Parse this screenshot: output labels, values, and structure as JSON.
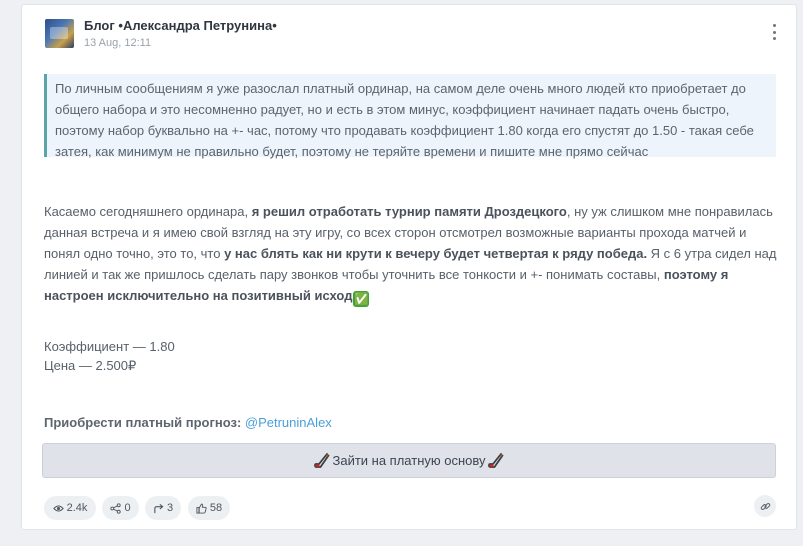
{
  "post": {
    "blog_title": "Блог •Александра Петрунина•",
    "date": "13 Aug, 12:11",
    "quote": "По личным сообщениям я уже разослал платный ординар, на самом деле очень много людей кто приобретает до общего набора и это несомненно радует, но и есть в этом минус, коэффициент начинает падать очень быстро, поэтому набор буквально на +- час, потому что продавать коэффициент 1.80 когда его спустят до 1.50 - такая себе затея, как минимум не правильно будет, поэтому не теряйте времени и пишите мне прямо сейчас",
    "paragraph": {
      "t1": "Касаемо сегодняшнего ординара, ",
      "b1": "я решил отработать турнир памяти Дроздецкого",
      "t2": ", ну уж слишком мне понравилась данная встреча и я имею свой взгляд на эту игру, со всех сторон отсмотрел возможные варианты прохода матчей и понял одно точно, это то, что ",
      "b2": "у нас блять как ни крути к вечеру будет четвертая к ряду победа.",
      "t3": " Я с 6 утра сидел над линией и так же пришлось сделать пару звонков чтобы уточнить все тонкости и +- понимать составы, ",
      "b3": "поэтому я настроен исключительно на позитивный исход",
      "emoji": "✅"
    },
    "coefficient": "Коэффициент — 1.80",
    "price": "Цена — 2.500₽",
    "buy_label": "Приобрести платный прогноз: ",
    "buy_link": "@PetruninAlex",
    "cta_label": "Зайти на платную основу",
    "stats": {
      "views": "2.4k",
      "shares": "0",
      "reposts": "3",
      "likes": "58"
    }
  },
  "icons": {
    "menu": "more-vertical-icon",
    "cta": "hockey-stick-icon",
    "views": "eye-icon",
    "shares": "share-nodes-icon",
    "reposts": "repost-arrow-icon",
    "likes": "thumbs-up-icon",
    "link": "link-icon"
  },
  "colors": {
    "accent_link": "#4a9fd8",
    "quote_border": "#5aa5a8",
    "quote_bg": "#eef4fb",
    "cta_bg": "#dfe3e9",
    "check_green": "#3aa33a"
  }
}
